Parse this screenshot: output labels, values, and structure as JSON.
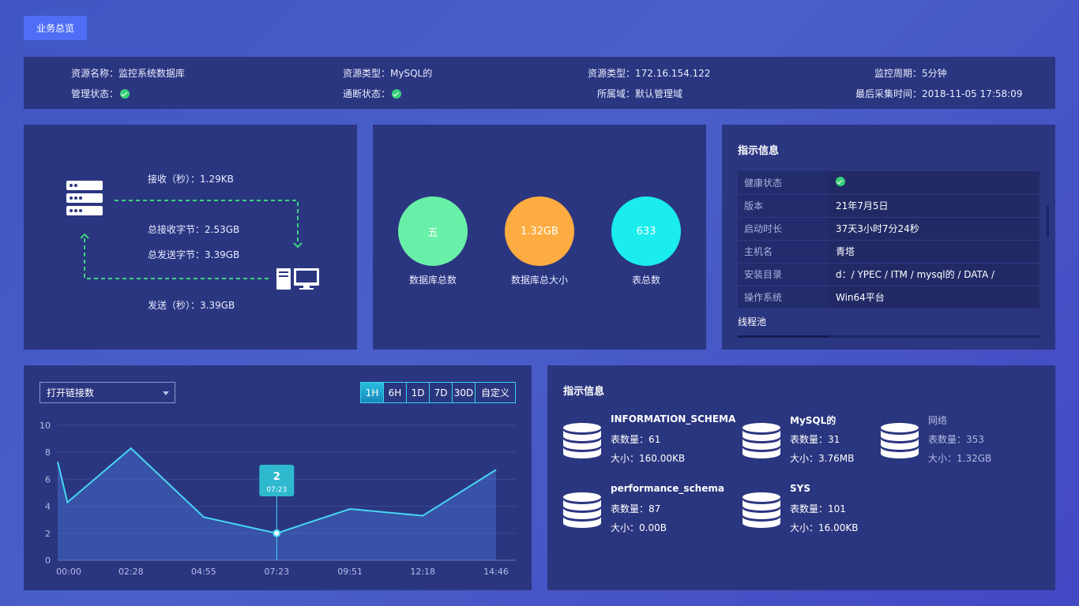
{
  "top_button": "业务总览",
  "info_bar": {
    "resource_name": "资源名称：监控系统数据库",
    "resource_type": "资源类型：MySQL的",
    "resource_ip": "资源类型：172.16.154.122",
    "monitor_period": "监控周期：5分钟",
    "manage_status": "管理状态：",
    "conn_status": "通断状态：",
    "domain": "所属域：默认管理域",
    "last_collect": "最后采集时间：2018-11-05 17:58:09"
  },
  "flow": {
    "receive_rate": "接收（秒）：1.29KB",
    "total_received": "总接收字节：2.53GB",
    "total_sent": "总发送字节：3.39GB",
    "send_rate": "发送（秒）：3.39GB"
  },
  "stats": [
    {
      "value": "五",
      "label": "数据库总数",
      "color": "#69f0a8"
    },
    {
      "value": "1.32GB",
      "label": "数据库总大小",
      "color": "#fdac41"
    },
    {
      "value": "633",
      "label": "表总数",
      "color": "#1beced"
    }
  ],
  "info_panel": {
    "title": "指示信息",
    "rows": [
      {
        "key": "健康状态",
        "value": ""
      },
      {
        "key": "版本",
        "value": "21年7月5日"
      },
      {
        "key": "启动时长",
        "value": "37天3小时7分24秒"
      },
      {
        "key": "主机名",
        "value": "青塔"
      },
      {
        "key": "安装目录",
        "value": "d：/ YPEC / ITM / mysql的 / DATA /"
      },
      {
        "key": "操作系统",
        "value": "Win64平台"
      }
    ],
    "thread_pool": "线程池"
  },
  "chart_panel": {
    "select_value": "打开链接数",
    "ranges": [
      "1H",
      "6H",
      "1D",
      "7D",
      "30D",
      "自定义"
    ],
    "active_range": "1H"
  },
  "chart_data": {
    "type": "area",
    "x": [
      "00:00",
      "00:20",
      "02:28",
      "04:55",
      "07:23",
      "09:51",
      "12:18",
      "14:46"
    ],
    "x_numeric": [
      0,
      0.33,
      2.47,
      4.92,
      7.38,
      9.85,
      12.3,
      14.77
    ],
    "y": [
      7.3,
      4.3,
      8.3,
      3.2,
      2.0,
      3.8,
      3.3,
      6.7
    ],
    "x_ticks": [
      "00:00",
      "02:28",
      "04:55",
      "07:23",
      "09:51",
      "12:18",
      "14:46"
    ],
    "y_ticks": [
      0,
      2,
      4,
      6,
      8,
      10
    ],
    "ylim": [
      0,
      10
    ],
    "tooltip": {
      "value": "2",
      "time": "07:23"
    },
    "line_color": "#47d6f5",
    "grid": true
  },
  "db_panel": {
    "title": "指示信息",
    "count_prefix": "表数量：",
    "size_prefix": "大小：",
    "items": [
      {
        "name": "INFORMATION_SCHEMA",
        "count": "表数量：61",
        "size": "大小：160.00KB",
        "dim": false
      },
      {
        "name": "MySQL的",
        "count": "表数量：31",
        "size": "大小：3.76MB",
        "dim": false
      },
      {
        "name": "网络",
        "count": "表数量：353",
        "size": "大小：1.32GB",
        "dim": true
      },
      {
        "name": "performance_schema",
        "count": "表数量：87",
        "size": "大小：0.00B",
        "dim": false
      },
      {
        "name": "SYS",
        "count": "表数量：101",
        "size": "大小：16.00KB",
        "dim": false
      }
    ]
  }
}
